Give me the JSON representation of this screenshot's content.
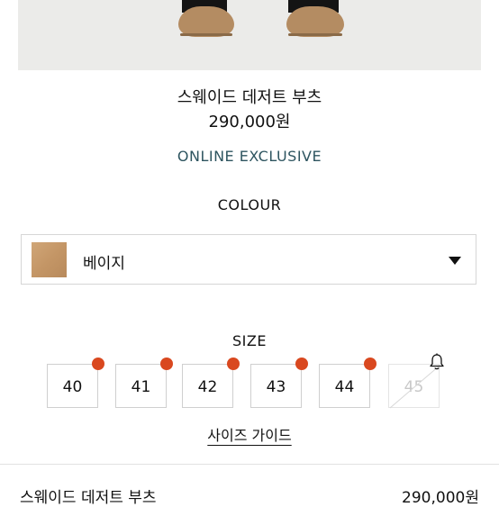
{
  "product": {
    "name": "스웨이드 데저트 부츠",
    "price": "290,000원",
    "badge": "ONLINE EXCLUSIVE"
  },
  "colour": {
    "title": "COLOUR",
    "selected": "베이지",
    "swatch_color": "#c89c6e"
  },
  "size": {
    "title": "SIZE",
    "options": [
      {
        "label": "40",
        "available": true
      },
      {
        "label": "41",
        "available": true
      },
      {
        "label": "42",
        "available": true
      },
      {
        "label": "43",
        "available": true
      },
      {
        "label": "44",
        "available": true
      },
      {
        "label": "45",
        "available": false
      }
    ],
    "guide_label": "사이즈 가이드"
  },
  "footer": {
    "name": "스웨이드 데저트 부츠",
    "price": "290,000원"
  },
  "colors": {
    "accent_dot": "#d9481f",
    "badge_text": "#2e5560"
  }
}
